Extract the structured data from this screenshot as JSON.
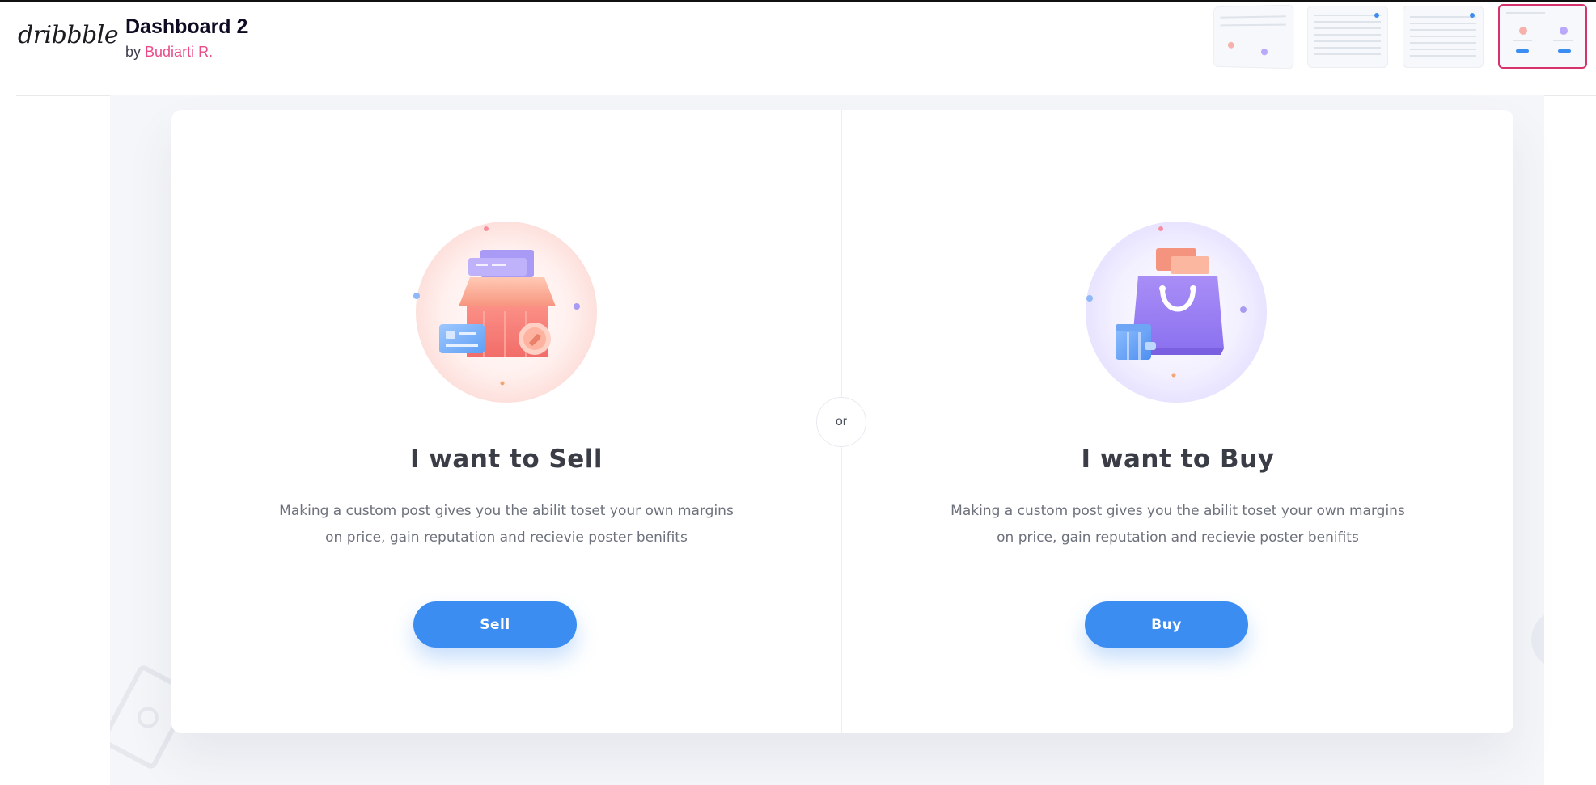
{
  "header": {
    "logo": "dribbble",
    "title": "Dashboard 2",
    "by_prefix": "by",
    "author": "Budiarti R.",
    "thumbnails_count": 4,
    "active_thumbnail": 4
  },
  "main": {
    "divider_label": "or",
    "sell": {
      "icon": "store-icon",
      "title": "I want to Sell",
      "description": "Making a custom post gives you the abilit toset your own margins on price, gain reputation and recievie poster benifits",
      "button_label": "Sell"
    },
    "buy": {
      "icon": "shopping-bag-icon",
      "title": "I want to Buy",
      "description": "Making a custom post gives you the abilit toset your own margins on price, gain reputation and recievie poster benifits",
      "button_label": "Buy"
    }
  },
  "colors": {
    "accent": "#3b8df2",
    "author_link": "#ea4c89",
    "active_thumb_border": "#d6336c",
    "sell_tint": "#ffe7e4",
    "buy_tint": "#ece9ff"
  },
  "decor_icons": [
    "bill-icon",
    "dollar-coin-icon"
  ]
}
